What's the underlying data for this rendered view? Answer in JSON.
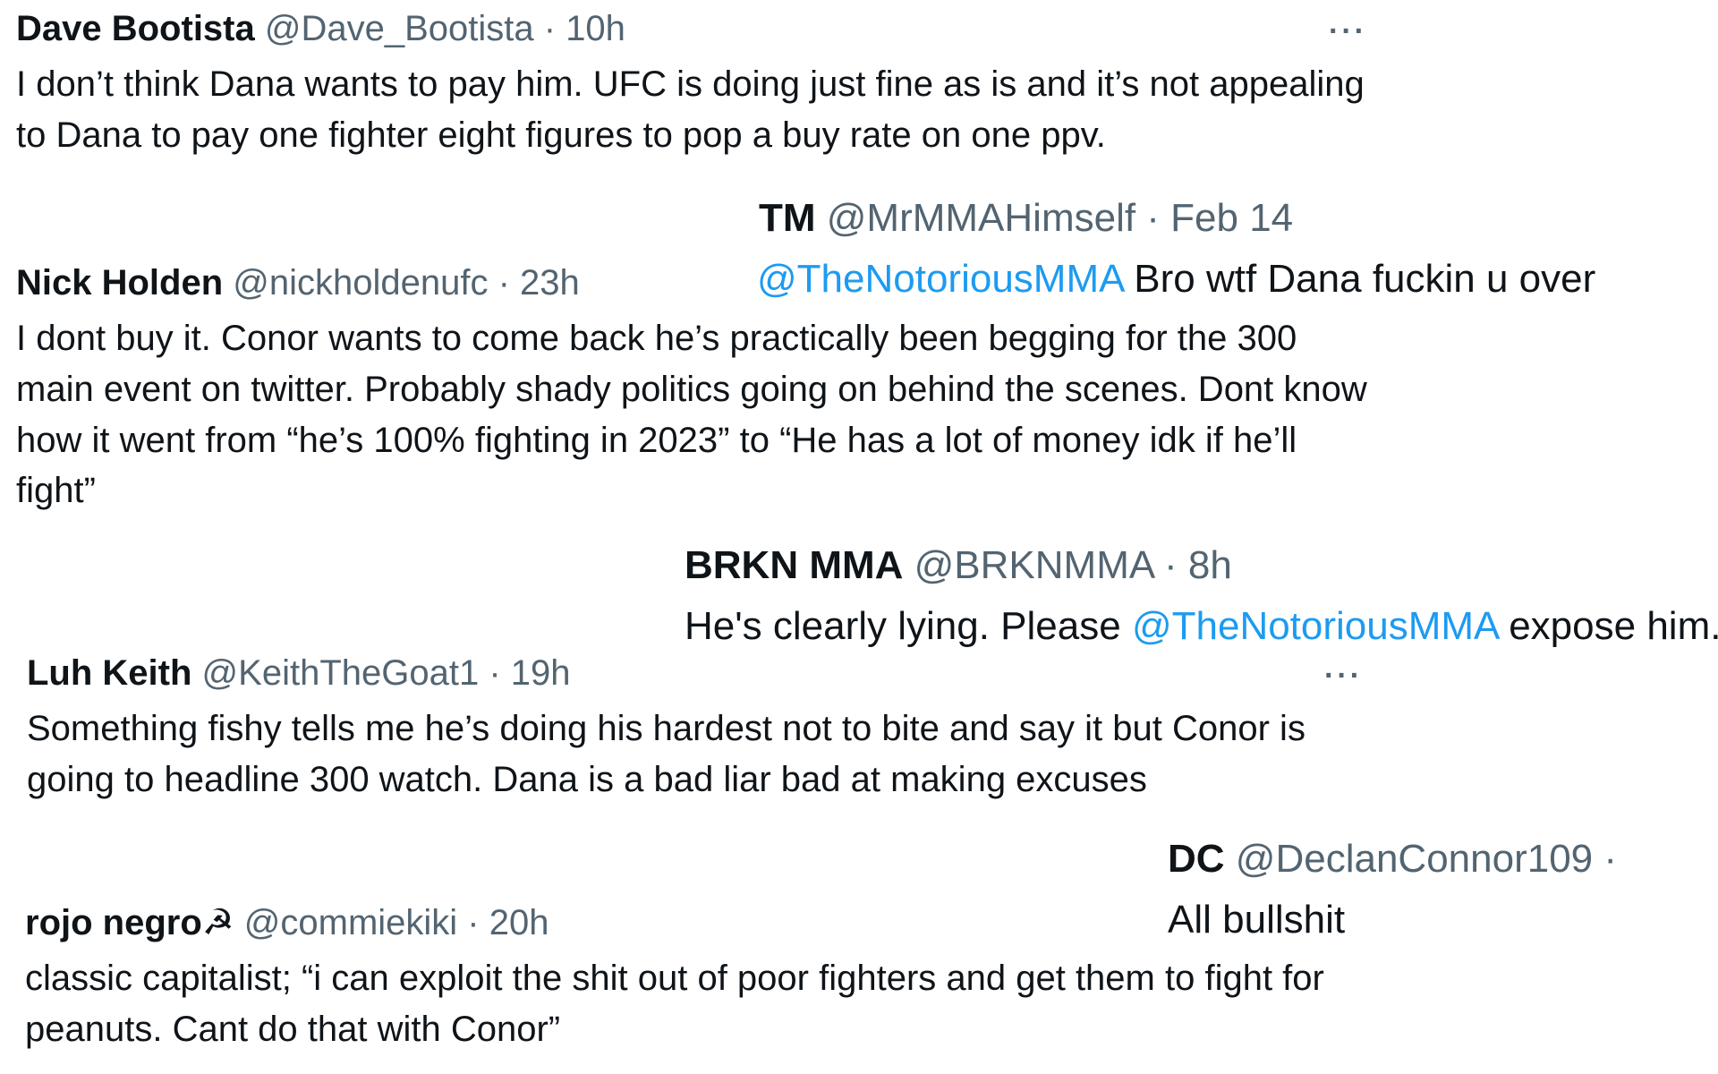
{
  "tweets": [
    {
      "name": "Dave Bootista",
      "handle": "@Dave_Bootista",
      "sep": " · ",
      "time": "10h",
      "text": "I don’t think Dana wants to pay him. UFC is doing just fine as is and it’s not appealing to Dana to pay one fighter eight figures to pop a buy rate on one ppv.",
      "more": "···"
    },
    {
      "name": "TM",
      "handle": "@MrMMAHimself",
      "sep": " · ",
      "time": "Feb 14",
      "mention": "@TheNotoriousMMA",
      "text": " Bro wtf Dana fuckin u over"
    },
    {
      "name": "Nick Holden",
      "handle": "@nickholdenufc",
      "sep": " · ",
      "time": "23h",
      "text": "I dont buy it. Conor wants to come back he’s practically been begging for the 300 main event on twitter. Probably shady politics going on behind the scenes. Dont know how it went from “he’s 100% fighting in 2023” to “He has a lot of money idk if he’ll fight”"
    },
    {
      "name": "BRKN MMA",
      "handle": "@BRKNMMA",
      "sep": " · ",
      "time": "8h",
      "text_before": "He's clearly lying. Please ",
      "mention": "@TheNotoriousMMA",
      "text_after": " expose him."
    },
    {
      "name": "Luh Keith",
      "handle": "@KeithTheGoat1",
      "sep": " · ",
      "time": "19h",
      "text": "Something fishy tells me he’s doing his hardest not to bite and say it but Conor is going to headline 300 watch. Dana is a bad liar bad at making excuses",
      "more": "···"
    },
    {
      "name": "DC",
      "handle": "@DeclanConnor109",
      "sep": " ·",
      "text": "All bullshit"
    },
    {
      "name": "rojo negro☭",
      "handle": "@commiekiki",
      "sep": " · ",
      "time": "20h",
      "text": "classic capitalist; “i can exploit the shit out of poor fighters and get them to fight for peanuts. Cant do that with Conor”"
    }
  ]
}
